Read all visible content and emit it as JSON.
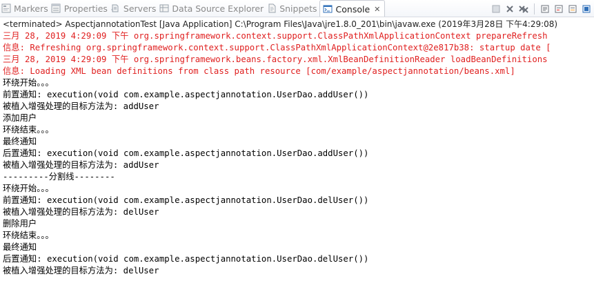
{
  "tabs": [
    {
      "label": "Markers",
      "icon": "markers-icon",
      "active": false
    },
    {
      "label": "Properties",
      "icon": "properties-icon",
      "active": false
    },
    {
      "label": "Servers",
      "icon": "servers-icon",
      "active": false
    },
    {
      "label": "Data Source Explorer",
      "icon": "data-source-explorer-icon",
      "active": false
    },
    {
      "label": "Snippets",
      "icon": "snippets-icon",
      "active": false
    },
    {
      "label": "Console",
      "icon": "console-icon",
      "active": true
    }
  ],
  "status": "<terminated> AspectjannotationTest [Java Application] C:\\Program Files\\Java\\jre1.8.0_201\\bin\\javaw.exe (2019年3月28日 下午4:29:08)",
  "colors": {
    "stderr": "#e02020",
    "stdout": "#000000",
    "accent": "#2f6fb8"
  },
  "console_lines": [
    {
      "text": "三月 28, 2019 4:29:09 下午 org.springframework.context.support.ClassPathXmlApplicationContext prepareRefresh",
      "stream": "err"
    },
    {
      "text": "信息: Refreshing org.springframework.context.support.ClassPathXmlApplicationContext@2e817b38: startup date [",
      "stream": "err"
    },
    {
      "text": "三月 28, 2019 4:29:09 下午 org.springframework.beans.factory.xml.XmlBeanDefinitionReader loadBeanDefinitions",
      "stream": "err"
    },
    {
      "text": "信息: Loading XML bean definitions from class path resource [com/example/aspectjannotation/beans.xml]",
      "stream": "err"
    },
    {
      "text": "环绕开始。。。",
      "stream": "out"
    },
    {
      "text": "前置通知: execution(void com.example.aspectjannotation.UserDao.addUser())",
      "stream": "out"
    },
    {
      "text": "被植入增强处理的目标方法为: addUser",
      "stream": "out"
    },
    {
      "text": "添加用户",
      "stream": "out"
    },
    {
      "text": "环绕结束。。。",
      "stream": "out"
    },
    {
      "text": "最终通知",
      "stream": "out"
    },
    {
      "text": "后置通知: execution(void com.example.aspectjannotation.UserDao.addUser())",
      "stream": "out"
    },
    {
      "text": "被植入增强处理的目标方法为: addUser",
      "stream": "out"
    },
    {
      "text": "---------分割线--------",
      "stream": "out"
    },
    {
      "text": "环绕开始。。。",
      "stream": "out"
    },
    {
      "text": "前置通知: execution(void com.example.aspectjannotation.UserDao.delUser())",
      "stream": "out"
    },
    {
      "text": "被植入增强处理的目标方法为: delUser",
      "stream": "out"
    },
    {
      "text": "删除用户",
      "stream": "out"
    },
    {
      "text": "环绕结束。。。",
      "stream": "out"
    },
    {
      "text": "最终通知",
      "stream": "out"
    },
    {
      "text": "后置通知: execution(void com.example.aspectjannotation.UserDao.delUser())",
      "stream": "out"
    },
    {
      "text": "被植入增强处理的目标方法为: delUser",
      "stream": "out"
    }
  ],
  "toolbar": [
    {
      "icon": "terminate-icon"
    },
    {
      "icon": "remove-launch-icon"
    },
    {
      "icon": "remove-all-terminated-icon"
    },
    {
      "icon": "scroll-lock-icon"
    },
    {
      "icon": "show-console-on-output-icon"
    },
    {
      "icon": "display-selected-console-icon"
    },
    {
      "icon": "pin-console-icon"
    }
  ]
}
